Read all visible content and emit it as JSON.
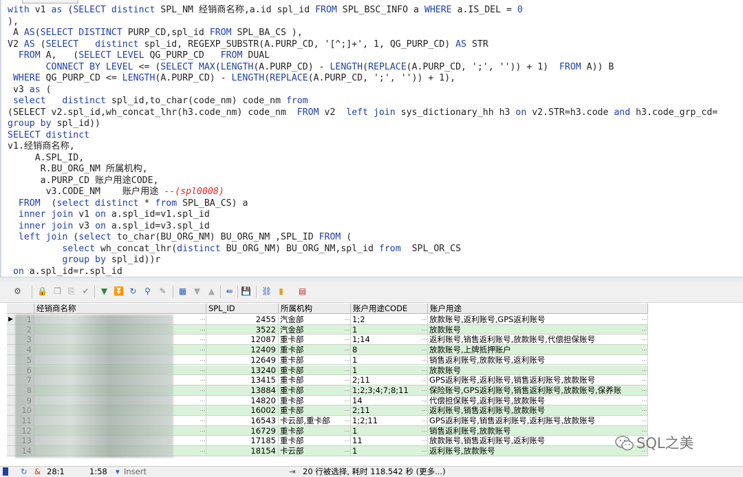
{
  "editor": {
    "lines": [
      [
        [
          "kw",
          "with"
        ],
        [
          "t",
          " v1 "
        ],
        [
          "kw",
          "as"
        ],
        [
          "t",
          " ("
        ],
        [
          "kw",
          "SELECT distinct"
        ],
        [
          "t",
          " SPL_NM 经销商名称,a.id spl_id "
        ],
        [
          "kw",
          "FROM"
        ],
        [
          "t",
          " SPL_BSC_INFO a "
        ],
        [
          "kw",
          "WHERE"
        ],
        [
          "t",
          " a.IS_DEL = "
        ],
        [
          "kw",
          "0"
        ]
      ],
      [
        [
          "t",
          "),"
        ]
      ],
      [
        [
          "t",
          " A "
        ],
        [
          "kw",
          "AS"
        ],
        [
          "t",
          "("
        ],
        [
          "kw",
          "SELECT DISTINCT"
        ],
        [
          "t",
          " PURP_CD,spl_id "
        ],
        [
          "kw",
          "FROM"
        ],
        [
          "t",
          " SPL_BA_CS ),"
        ]
      ],
      [
        [
          "t",
          "V2 "
        ],
        [
          "kw",
          "AS"
        ],
        [
          "t",
          " ("
        ],
        [
          "kw",
          "SELECT"
        ],
        [
          "t",
          "   "
        ],
        [
          "kw",
          "distinct"
        ],
        [
          "t",
          " spl_id, REGEXP_SUBSTR(A.PURP_CD, '[^;]+', 1, QG_PURP_CD) "
        ],
        [
          "kw",
          "AS"
        ],
        [
          "t",
          " STR"
        ]
      ],
      [
        [
          "t",
          "  "
        ],
        [
          "kw",
          "FROM"
        ],
        [
          "t",
          " A,   ("
        ],
        [
          "kw",
          "SELECT LEVEL"
        ],
        [
          "t",
          " QG_PURP_CD   "
        ],
        [
          "kw",
          "FROM"
        ],
        [
          "t",
          " DUAL"
        ]
      ],
      [
        [
          "t",
          "       "
        ],
        [
          "kw",
          "CONNECT BY LEVEL"
        ],
        [
          "t",
          " <= ("
        ],
        [
          "kw",
          "SELECT MAX"
        ],
        [
          "t",
          "("
        ],
        [
          "kw",
          "LENGTH"
        ],
        [
          "t",
          "(A.PURP_CD) - "
        ],
        [
          "kw",
          "LENGTH"
        ],
        [
          "t",
          "("
        ],
        [
          "kw",
          "REPLACE"
        ],
        [
          "t",
          "(A.PURP_CD, ';', '')) + 1)  "
        ],
        [
          "kw",
          "FROM"
        ],
        [
          "t",
          " A)) B"
        ]
      ],
      [
        [
          "t",
          " "
        ],
        [
          "kw",
          "WHERE"
        ],
        [
          "t",
          " QG_PURP_CD <= "
        ],
        [
          "kw",
          "LENGTH"
        ],
        [
          "t",
          "(A.PURP_CD) - "
        ],
        [
          "kw",
          "LENGTH"
        ],
        [
          "t",
          "("
        ],
        [
          "kw",
          "REPLACE"
        ],
        [
          "t",
          "(A.PURP_CD, ';', '')) + 1),"
        ]
      ],
      [
        [
          "t",
          " v3 "
        ],
        [
          "kw",
          "as"
        ],
        [
          "t",
          " ("
        ]
      ],
      [
        [
          "t",
          " "
        ],
        [
          "kw",
          "select"
        ],
        [
          "t",
          "   "
        ],
        [
          "kw",
          "distinct"
        ],
        [
          "t",
          " spl_id,to_char(code_nm) code_nm "
        ],
        [
          "kw",
          "from"
        ]
      ],
      [
        [
          "t",
          "(SELECT v2.spl_id,wh_concat_lhr(h3.code_nm) code_nm  "
        ],
        [
          "kw",
          "FROM"
        ],
        [
          "t",
          " v2  "
        ],
        [
          "kw",
          "left join"
        ],
        [
          "t",
          " sys_dictionary_hh h3 "
        ],
        [
          "kw",
          "on"
        ],
        [
          "t",
          " v2.STR=h3.code "
        ],
        [
          "kw",
          "and"
        ],
        [
          "t",
          " h3.code_grp_cd="
        ]
      ],
      [
        [
          "kw",
          "group by"
        ],
        [
          "t",
          " spl_id))"
        ]
      ],
      [
        [
          "kw",
          "SELECT distinct"
        ]
      ],
      [
        [
          "t",
          "v1.经销商名称,"
        ]
      ],
      [
        [
          "t",
          "     A.SPL_ID,"
        ]
      ],
      [
        [
          "t",
          "      R.BU_ORG_NM 所属机构,"
        ]
      ],
      [
        [
          "t",
          "      a.PURP_CD 账户用途CODE,"
        ]
      ],
      [
        [
          "t",
          "       v3.CODE_NM    账户用途 "
        ],
        [
          "cm",
          "--(spl0008)"
        ]
      ],
      [
        [
          "t",
          "  "
        ],
        [
          "kw",
          "FROM"
        ],
        [
          "t",
          "  ("
        ],
        [
          "kw",
          "select distinct"
        ],
        [
          "t",
          " * "
        ],
        [
          "kw",
          "from"
        ],
        [
          "t",
          " SPL_BA_CS) a"
        ]
      ],
      [
        [
          "t",
          "  "
        ],
        [
          "kw",
          "inner join"
        ],
        [
          "t",
          " v1 "
        ],
        [
          "kw",
          "on"
        ],
        [
          "t",
          " a.spl_id=v1.spl_id"
        ]
      ],
      [
        [
          "t",
          "  "
        ],
        [
          "kw",
          "inner join"
        ],
        [
          "t",
          " v3 "
        ],
        [
          "kw",
          "on"
        ],
        [
          "t",
          " a.spl_id=v3.spl_id"
        ]
      ],
      [
        [
          "t",
          "  "
        ],
        [
          "kw",
          "left join"
        ],
        [
          "t",
          " ("
        ],
        [
          "kw",
          "select"
        ],
        [
          "t",
          " to_char(BU_ORG_NM) BU_ORG_NM ,SPL_ID "
        ],
        [
          "kw",
          "FROM"
        ],
        [
          "t",
          " ("
        ]
      ],
      [
        [
          "t",
          "          "
        ],
        [
          "kw",
          "select"
        ],
        [
          "t",
          " wh_concat_lhr("
        ],
        [
          "kw",
          "distinct"
        ],
        [
          "t",
          " BU_ORG_NM) BU_ORG_NM,spl_id "
        ],
        [
          "kw",
          "from"
        ],
        [
          "t",
          "  SPL_OR_CS"
        ]
      ],
      [
        [
          "t",
          "          "
        ],
        [
          "kw",
          "group by"
        ],
        [
          "t",
          " spl_id))r"
        ]
      ],
      [
        [
          "t",
          " "
        ],
        [
          "kw",
          "on"
        ],
        [
          "t",
          " a.spl_id=r.spl_id"
        ]
      ]
    ]
  },
  "toolbar": {
    "icons": [
      "grid-settings-icon",
      "lock-icon",
      "copy-icon",
      "paste-icon",
      "check-icon",
      "down-arrow-icon",
      "down-double-arrow-icon",
      "refresh-icon",
      "find-icon",
      "clear-icon",
      "query-icon",
      "dropdown-icon",
      "up-icon",
      "export-icon",
      "save-icon",
      "link-icon",
      "chart-icon",
      "table-icon"
    ]
  },
  "grid": {
    "columns": [
      "经销商名称",
      "SPL_ID",
      "所属机构",
      "账户用途CODE",
      "账户用途"
    ],
    "rows": [
      {
        "n": "1",
        "name": "",
        "id": "2455",
        "org": "汽金部",
        "code": "1;2",
        "purpose": "放款账号,返利账号,GPS返利账号"
      },
      {
        "n": "2",
        "name": "",
        "id": "3522",
        "org": "汽金部",
        "code": "1",
        "purpose": "放款账号"
      },
      {
        "n": "3",
        "name": "",
        "id": "12087",
        "org": "重卡部",
        "code": "1;14",
        "purpose": "返利账号,销售返利账号,放款账号,代偿担保账号"
      },
      {
        "n": "4",
        "name": "",
        "id": "12409",
        "org": "重卡部",
        "code": "8",
        "purpose": "放款账号,上牌抵押账户"
      },
      {
        "n": "5",
        "name": "",
        "id": "12649",
        "org": "重卡部",
        "code": "1",
        "purpose": "销售返利账号,放款账号,返利账号"
      },
      {
        "n": "6",
        "name": "",
        "id": "13240",
        "org": "重卡部",
        "code": "1",
        "purpose": "放款账号"
      },
      {
        "n": "7",
        "name": "",
        "id": "13415",
        "org": "重卡部",
        "code": "2;11",
        "purpose": "GPS返利账号,返利账号,销售返利账号,放款账号"
      },
      {
        "n": "8",
        "name": "",
        "id": "13884",
        "org": "重卡部",
        "code": "1;2;3;4;7;8;11",
        "purpose": "保险账号,GPS返利账号,销售返利账号,放款账号,保养账"
      },
      {
        "n": "9",
        "name": "",
        "id": "14820",
        "org": "重卡部",
        "code": "14",
        "purpose": "代偿担保账号,返利账号,放款账号"
      },
      {
        "n": "10",
        "name": "",
        "id": "16002",
        "org": "重卡部",
        "code": "2;11",
        "purpose": "返利账号,销售返利账号,放款账号"
      },
      {
        "n": "11",
        "name": "",
        "id": "16543",
        "org": "卡云部,重卡部",
        "code": "1;2;11",
        "purpose": "GPS返利账号,销售返利账号,返利账号,放款账号"
      },
      {
        "n": "12",
        "name": "",
        "id": "16729",
        "org": "重卡部",
        "code": "1",
        "purpose": "销售返利账号,放款账号"
      },
      {
        "n": "13",
        "name": "",
        "id": "17185",
        "org": "重卡部",
        "code": "11",
        "purpose": "放款账号,销售返利账号,返利账号"
      },
      {
        "n": "14",
        "name": "",
        "id": "18154",
        "org": "卡云部",
        "code": "1",
        "purpose": "返利账号,放款账号"
      }
    ]
  },
  "status": {
    "position": "28:1",
    "time": "1:58",
    "mode": "Insert",
    "message": "20 行被选择, 耗时 118.542 秒 (更多...)"
  },
  "watermark": {
    "text": "SQL之美"
  }
}
